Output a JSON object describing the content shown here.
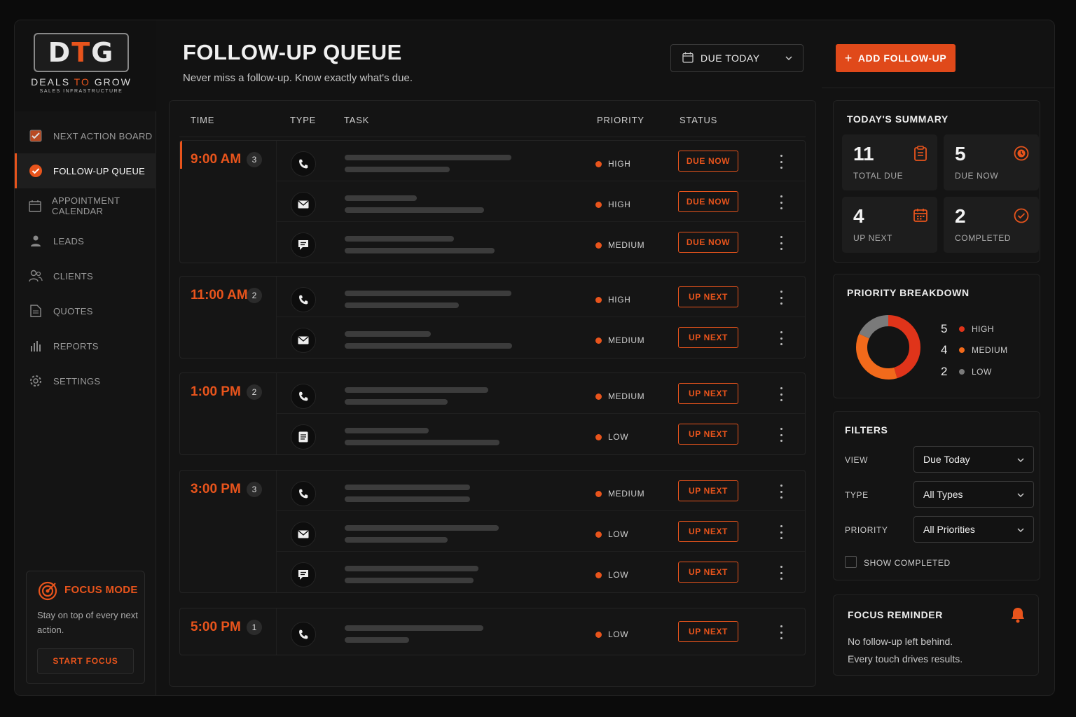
{
  "brand": {
    "badge_prefix": "D",
    "badge_accent": "T",
    "badge_suffix": "G",
    "name_start": "DEALS ",
    "name_accent": "TO",
    "name_end": " GROW",
    "tagline": "SALES INFRASTRUCTURE",
    "accent_color": "#e8541c"
  },
  "sidebar": {
    "items": [
      {
        "label": "NEXT ACTION BOARD",
        "icon": "checkbox-icon"
      },
      {
        "label": "FOLLOW-UP QUEUE",
        "icon": "check-circle-icon",
        "active": true
      },
      {
        "label": "APPOINTMENT CALENDAR",
        "icon": "calendar-icon"
      },
      {
        "label": "LEADS",
        "icon": "person-icon"
      },
      {
        "label": "CLIENTS",
        "icon": "people-icon"
      },
      {
        "label": "QUOTES",
        "icon": "document-icon"
      },
      {
        "label": "REPORTS",
        "icon": "bar-chart-icon"
      },
      {
        "label": "SETTINGS",
        "icon": "gear-icon"
      }
    ],
    "focus": {
      "title": "FOCUS MODE",
      "text": "Stay on top of every next action.",
      "button": "START FOCUS"
    }
  },
  "header": {
    "title": "FOLLOW-UP QUEUE",
    "subtitle": "Never miss a follow-up. Know exactly what's due.",
    "date_filter": "DUE TODAY",
    "add_button": "ADD FOLLOW-UP"
  },
  "table": {
    "columns": {
      "time": "TIME",
      "type": "TYPE",
      "task": "TASK",
      "priority": "PRIORITY",
      "status": "STATUS"
    },
    "groups": [
      {
        "time": "9:00 AM",
        "count": "3",
        "rows": [
          {
            "type": "phone",
            "priority": "HIGH",
            "status": "DUE NOW"
          },
          {
            "type": "email",
            "priority": "HIGH",
            "status": "DUE NOW"
          },
          {
            "type": "message",
            "priority": "MEDIUM",
            "status": "DUE NOW"
          }
        ]
      },
      {
        "time": "11:00 AM",
        "count": "2",
        "rows": [
          {
            "type": "phone",
            "priority": "HIGH",
            "status": "UP NEXT"
          },
          {
            "type": "email",
            "priority": "MEDIUM",
            "status": "UP NEXT"
          }
        ]
      },
      {
        "time": "1:00 PM",
        "count": "2",
        "rows": [
          {
            "type": "phone",
            "priority": "MEDIUM",
            "status": "UP NEXT"
          },
          {
            "type": "note",
            "priority": "LOW",
            "status": "UP NEXT"
          }
        ]
      },
      {
        "time": "3:00 PM",
        "count": "3",
        "rows": [
          {
            "type": "phone",
            "priority": "MEDIUM",
            "status": "UP NEXT"
          },
          {
            "type": "email",
            "priority": "LOW",
            "status": "UP NEXT"
          },
          {
            "type": "message",
            "priority": "LOW",
            "status": "UP NEXT"
          }
        ]
      },
      {
        "time": "5:00 PM",
        "count": "1",
        "rows": [
          {
            "type": "phone",
            "priority": "LOW",
            "status": "UP NEXT"
          }
        ]
      }
    ]
  },
  "summary": {
    "title": "TODAY'S SUMMARY",
    "stats": [
      {
        "value": "11",
        "label": "TOTAL DUE",
        "icon": "clipboard-icon"
      },
      {
        "value": "5",
        "label": "DUE NOW",
        "icon": "alarm-icon"
      },
      {
        "value": "4",
        "label": "UP NEXT",
        "icon": "calendar-icon"
      },
      {
        "value": "2",
        "label": "COMPLETED",
        "icon": "check-circle-icon"
      }
    ]
  },
  "priority_breakdown": {
    "title": "PRIORITY BREAKDOWN",
    "items": [
      {
        "value": "5",
        "label": "HIGH",
        "color": "#e0341a"
      },
      {
        "value": "4",
        "label": "MEDIUM",
        "color": "#f26a1b"
      },
      {
        "value": "2",
        "label": "LOW",
        "color": "#7a7a7a"
      }
    ]
  },
  "filters": {
    "title": "FILTERS",
    "view_label": "VIEW",
    "view_value": "Due Today",
    "type_label": "TYPE",
    "type_value": "All Types",
    "priority_label": "PRIORITY",
    "priority_value": "All Priorities",
    "show_completed": "SHOW COMPLETED"
  },
  "reminder": {
    "title": "FOCUS REMINDER",
    "line1": "No follow-up left behind.",
    "line2": "Every touch drives results."
  }
}
